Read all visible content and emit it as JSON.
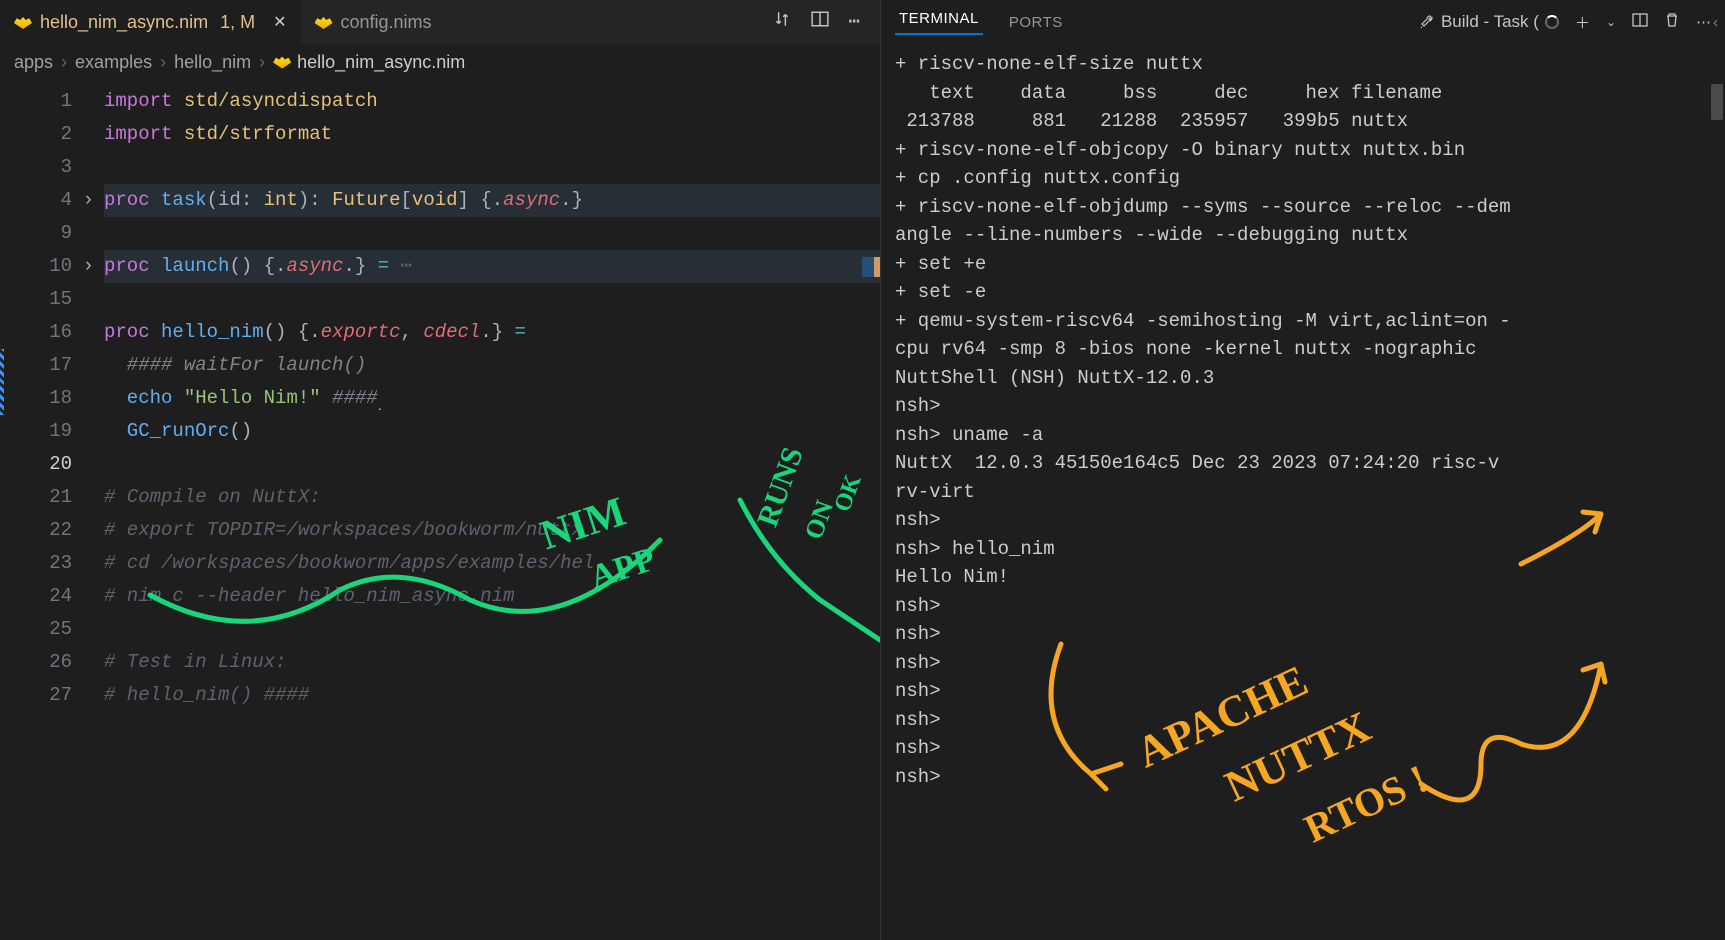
{
  "tabs": {
    "active": {
      "name": "hello_nim_async.nim",
      "badges": "1, M"
    },
    "inactive": {
      "name": "config.nims"
    }
  },
  "breadcrumbs": {
    "p0": "apps",
    "p1": "examples",
    "p2": "hello_nim",
    "p3": "hello_nim_async.nim"
  },
  "gutter": [
    "1",
    "2",
    "3",
    "4",
    "9",
    "10",
    "15",
    "16",
    "17",
    "18",
    "19",
    "20",
    "21",
    "22",
    "23",
    "24",
    "25",
    "26",
    "27"
  ],
  "code": {
    "l1_kw": "import",
    "l1_mod": "std/asyncdispatch",
    "l2_kw": "import",
    "l2_mod": "std/strformat",
    "l4": {
      "kw": "proc",
      "fn": "task",
      "p": "(",
      "id": "id",
      "colon": ": ",
      "ty": "int",
      "pc": "): ",
      "ret": "Future",
      "br": "[",
      "void": "void",
      "brc": "] ",
      "pragma_open": "{.",
      "pragma": "async",
      "pragma_close": ".}"
    },
    "l10": {
      "kw": "proc",
      "fn": "launch",
      "paren": "() ",
      "pragma_open": "{.",
      "pragma": "async",
      "pragma_close": ".} ",
      "eq": "=",
      "dots": " ⋯"
    },
    "l16": {
      "kw": "proc",
      "fn": "hello_nim",
      "paren": "() ",
      "pragma_open": "{.",
      "p1": "exportc",
      "comma": ", ",
      "p2": "cdecl",
      "pragma_close": ".} ",
      "eq": "="
    },
    "l17": "  #### waitFor launch()",
    "l18": {
      "echo": "  echo ",
      "str": "\"Hello Nim!\"",
      "tail": " ####"
    },
    "l18_caret": "˰",
    "l19": {
      "fn": "  GC_runOrc",
      "paren": "()"
    },
    "l21": "# Compile on NuttX:",
    "l22": "# export TOPDIR=/workspaces/bookworm/nuttx",
    "l23": "# cd /workspaces/bookworm/apps/examples/hel",
    "l24": "# nim c --header hello_nim_async.nim",
    "l26": "# Test in Linux:",
    "l27": "# hello_nim() ####"
  },
  "terminal": {
    "tabs": {
      "t1": "TERMINAL",
      "t2": "PORTS"
    },
    "task": "Build - Task (",
    "lines": [
      "+ riscv-none-elf-size nuttx",
      "   text    data     bss     dec     hex filename",
      " 213788     881   21288  235957   399b5 nuttx",
      "+ riscv-none-elf-objcopy -O binary nuttx nuttx.bin",
      "+ cp .config nuttx.config",
      "+ riscv-none-elf-objdump --syms --source --reloc --dem",
      "angle --line-numbers --wide --debugging nuttx",
      "+ set +e",
      "+ set -e",
      "+ qemu-system-riscv64 -semihosting -M virt,aclint=on -",
      "cpu rv64 -smp 8 -bios none -kernel nuttx -nographic",
      "",
      "NuttShell (NSH) NuttX-12.0.3",
      "nsh>",
      "nsh> uname -a",
      "NuttX  12.0.3 45150e164c5 Dec 23 2023 07:24:20 risc-v ",
      "rv-virt",
      "nsh>",
      "nsh> hello_nim",
      "Hello Nim!",
      "nsh>",
      "nsh>",
      "nsh>",
      "nsh>",
      "nsh>",
      "nsh>",
      "nsh>"
    ]
  },
  "annotations": {
    "nim": "NIM",
    "app": "APP",
    "runs": "RUNS",
    "on": "ON",
    "ok": "OK",
    "apache": "APACHE",
    "nuttx": "NUTTX",
    "rtos": "RTOS !"
  }
}
